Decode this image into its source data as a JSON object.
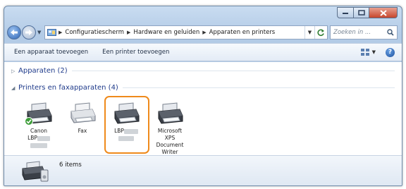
{
  "address_bar": {
    "crumbs": [
      "Configuratiescherm",
      "Hardware en geluiden",
      "Apparaten en printers"
    ],
    "search_placeholder": "Zoeken in ..."
  },
  "toolbar": {
    "add_device": "Een apparaat toevoegen",
    "add_printer": "Een printer toevoegen",
    "help": "?"
  },
  "groups": {
    "devices_title": "Apparaten (2)",
    "printers_title": "Printers en faxapparaten (4)"
  },
  "printers": [
    {
      "name_line1": "Canon",
      "name_line2": "LBP",
      "default": true
    },
    {
      "name_line1": "Fax"
    },
    {
      "name_line1": "LBP",
      "selected": true
    },
    {
      "name_line1": "Microsoft",
      "name_line2": "XPS",
      "name_line3": "Document",
      "name_line4": "Writer"
    }
  ],
  "details": {
    "count": "6 items"
  },
  "colors": {
    "selection": "#ef8a1b",
    "group_title": "#1e3a8a"
  }
}
